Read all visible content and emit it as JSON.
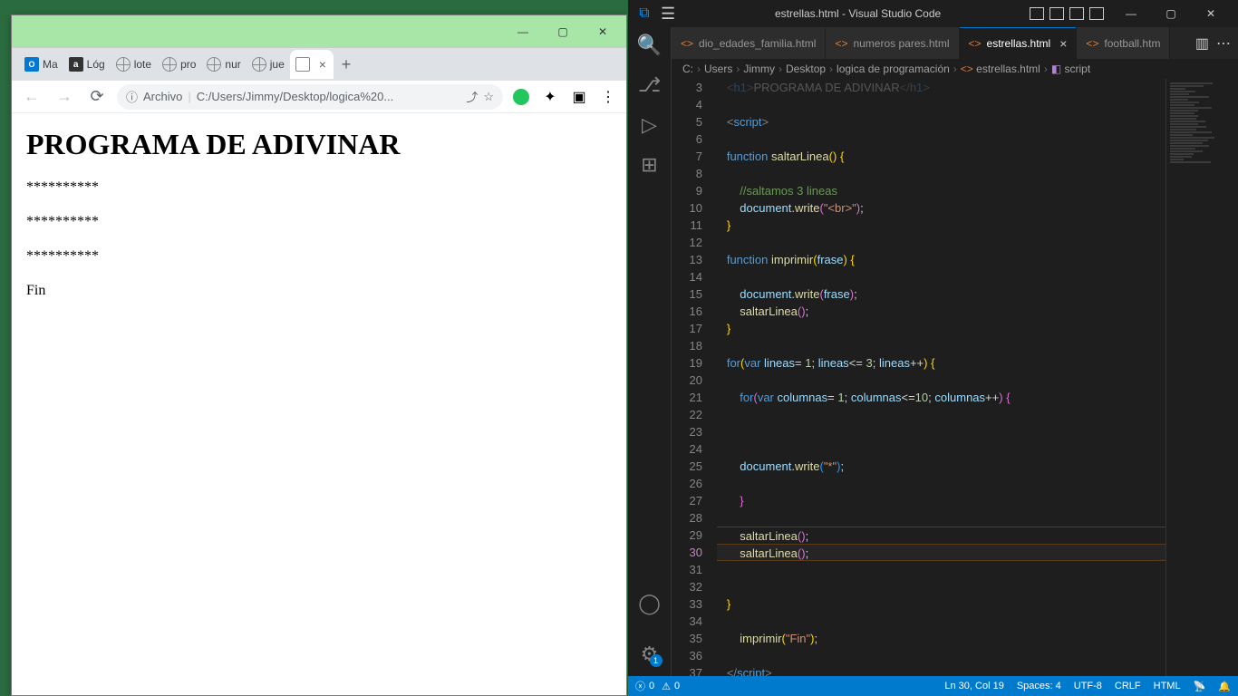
{
  "chrome": {
    "tabs": [
      {
        "favicon": "outlook",
        "label": "Ma"
      },
      {
        "favicon": "a",
        "label": "Lóg"
      },
      {
        "favicon": "globe",
        "label": "lote"
      },
      {
        "favicon": "globe",
        "label": "pro"
      },
      {
        "favicon": "globe",
        "label": "nur"
      },
      {
        "favicon": "globe",
        "label": "jue"
      },
      {
        "favicon": "doc",
        "label": ""
      }
    ],
    "url_prefix": "Archivo",
    "url": "C:/Users/Jimmy/Desktop/logica%20...",
    "page": {
      "heading": "PROGRAMA DE ADIVINAR",
      "stars_line": "**********",
      "fin": "Fin"
    }
  },
  "vscode": {
    "title": "estrellas.html - Visual Studio Code",
    "tabs": [
      {
        "label": "dio_edades_familia.html",
        "active": false,
        "truncated": true
      },
      {
        "label": "numeros pares.html",
        "active": false
      },
      {
        "label": "estrellas.html",
        "active": true,
        "closable": true
      },
      {
        "label": "football.htm",
        "active": false,
        "truncated": true
      }
    ],
    "breadcrumbs": [
      "C:",
      "Users",
      "Jimmy",
      "Desktop",
      "logica de programación",
      "estrellas.html",
      "script"
    ],
    "code_lines": [
      {
        "n": 3,
        "html": "   <span class='tag'>&lt;</span><span class='tagname'>h1</span><span class='tag'>&gt;</span><span class='pn'>PROGRAMA DE ADIVINAR</span><span class='tag'>&lt;/</span><span class='tagname'>h1</span><span class='tag'>&gt;</span>",
        "dim": true
      },
      {
        "n": 4,
        "html": ""
      },
      {
        "n": 5,
        "html": "   <span class='tag'>&lt;</span><span class='tagname'>script</span><span class='tag'>&gt;</span>"
      },
      {
        "n": 6,
        "html": ""
      },
      {
        "n": 7,
        "html": "   <span class='kw'>function</span> <span class='fn'>saltarLinea</span><span class='brace-y'>(</span><span class='brace-y'>)</span> <span class='brace-y'>{</span>"
      },
      {
        "n": 8,
        "html": ""
      },
      {
        "n": 9,
        "html": "       <span class='cm'>//saltamos 3 lineas</span>"
      },
      {
        "n": 10,
        "html": "       <span class='var'>document</span><span class='pn'>.</span><span class='fn'>write</span><span class='brace-p'>(</span><span class='str'>\"&lt;br&gt;\"</span><span class='brace-p'>)</span><span class='pn'>;</span>"
      },
      {
        "n": 11,
        "html": "   <span class='brace-y'>}</span>"
      },
      {
        "n": 12,
        "html": ""
      },
      {
        "n": 13,
        "html": "   <span class='kw'>function</span> <span class='fn'>imprimir</span><span class='brace-y'>(</span><span class='var'>frase</span><span class='brace-y'>)</span> <span class='brace-y'>{</span>"
      },
      {
        "n": 14,
        "html": ""
      },
      {
        "n": 15,
        "html": "       <span class='var'>document</span><span class='pn'>.</span><span class='fn'>write</span><span class='brace-p'>(</span><span class='var'>frase</span><span class='brace-p'>)</span><span class='pn'>;</span>"
      },
      {
        "n": 16,
        "html": "       <span class='fn'>saltarLinea</span><span class='brace-p'>(</span><span class='brace-p'>)</span><span class='pn'>;</span>"
      },
      {
        "n": 17,
        "html": "   <span class='brace-y'>}</span>"
      },
      {
        "n": 18,
        "html": ""
      },
      {
        "n": 19,
        "html": "   <span class='kw'>for</span><span class='brace-y'>(</span><span class='kw'>var</span> <span class='var'>lineas</span><span class='pn'>=</span> <span class='num'>1</span><span class='pn'>;</span> <span class='var'>lineas</span><span class='pn'>&lt;=</span> <span class='num'>3</span><span class='pn'>;</span> <span class='var'>lineas</span><span class='pn'>++</span><span class='brace-y'>)</span> <span class='brace-y'>{</span>"
      },
      {
        "n": 20,
        "html": ""
      },
      {
        "n": 21,
        "html": "       <span class='kw'>for</span><span class='brace-p'>(</span><span class='kw'>var</span> <span class='var'>columnas</span><span class='pn'>=</span> <span class='num'>1</span><span class='pn'>;</span> <span class='var'>columnas</span><span class='pn'>&lt;=</span><span class='num'>10</span><span class='pn'>;</span> <span class='var'>columnas</span><span class='pn'>++</span><span class='brace-p'>)</span> <span class='brace-p'>{</span>"
      },
      {
        "n": 22,
        "html": ""
      },
      {
        "n": 23,
        "html": ""
      },
      {
        "n": 24,
        "html": ""
      },
      {
        "n": 25,
        "html": "       <span class='var'>document</span><span class='pn'>.</span><span class='fn'>write</span><span class='brace-b'>(</span><span class='str'>\"*\"</span><span class='brace-b'>)</span><span class='pn'>;</span>"
      },
      {
        "n": 26,
        "html": ""
      },
      {
        "n": 27,
        "html": "       <span class='brace-p'>}</span>"
      },
      {
        "n": 28,
        "html": ""
      },
      {
        "n": 29,
        "html": "       <span class='fn'>saltarLinea</span><span class='brace-p'>(</span><span class='brace-p'>)</span><span class='pn'>;</span>",
        "hl_above": true
      },
      {
        "n": 30,
        "html": "       <span class='fn'>saltarLinea</span><span class='brace-p'>(</span><span class='brace-p'>)</span><span class='pn'>;</span>",
        "modified": true,
        "current": true
      },
      {
        "n": 31,
        "html": ""
      },
      {
        "n": 32,
        "html": ""
      },
      {
        "n": 33,
        "html": "   <span class='brace-y'>}</span>"
      },
      {
        "n": 34,
        "html": ""
      },
      {
        "n": 35,
        "html": "       <span class='fn'>imprimir</span><span class='brace-y'>(</span><span class='str'>\"Fin\"</span><span class='brace-y'>)</span><span class='pn'>;</span>"
      },
      {
        "n": 36,
        "html": ""
      },
      {
        "n": 37,
        "html": "   <span class='tag'>&lt;/</span><span class='tagname'>script</span><span class='tag'>&gt;</span>"
      }
    ],
    "statusbar": {
      "errors": "0",
      "warnings": "0",
      "position": "Ln 30, Col 19",
      "spaces": "Spaces: 4",
      "encoding": "UTF-8",
      "eol": "CRLF",
      "lang": "HTML",
      "settings_badge": "1"
    }
  }
}
